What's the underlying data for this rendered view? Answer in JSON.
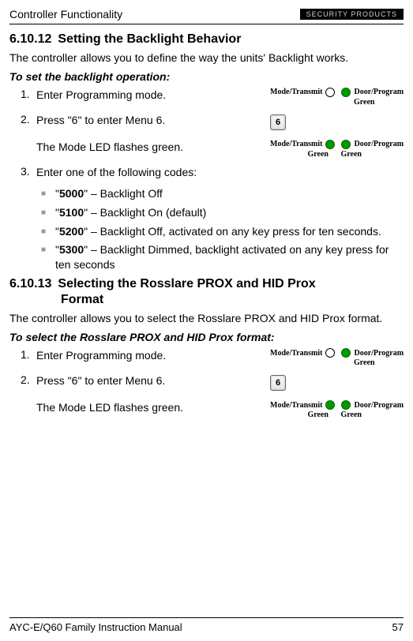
{
  "header": {
    "title": "Controller Functionality",
    "brand": "SECURITY PRODUCTS"
  },
  "s1": {
    "num": "6.10.12",
    "title": "Setting the Backlight Behavior",
    "intro": "The controller allows you to define the way the units' Backlight works.",
    "procTitle": "To set the backlight operation:",
    "step1": {
      "num": "1.",
      "text": "Enter Programming mode."
    },
    "step2": {
      "num": "2.",
      "textPre": " Press \"",
      "bold": "6",
      "textPost": "\" to enter Menu 6."
    },
    "step2b": "The Mode LED flashes green.",
    "step3": {
      "num": "3.",
      "text": "Enter one of the following codes:"
    },
    "bullets": [
      {
        "code": "5000",
        "desc": "\" – Backlight Off"
      },
      {
        "code": "5100",
        "desc": "\" – Backlight On (default)"
      },
      {
        "code": "5200",
        "desc": "\" – Backlight Off, activated on any key press for ten seconds."
      },
      {
        "code": "5300",
        "desc": "\" – Backlight Dimmed, backlight activated on any key press for ten seconds"
      }
    ]
  },
  "s2": {
    "num": "6.10.13",
    "title": "Selecting the Rosslare PROX and HID Prox",
    "title2": "Format",
    "intro": "The controller allows you to select the Rosslare PROX and HID Prox format.",
    "procTitle": "To select the Rosslare PROX and HID Prox format:",
    "step1": {
      "num": "1.",
      "text": "Enter Programming mode."
    },
    "step2": {
      "num": "2.",
      "textPre": " Press \"",
      "bold": "6",
      "textPost": "\" to enter Menu 6."
    },
    "step2b": "The Mode LED flashes green."
  },
  "led": {
    "mode": "Mode/Transmit",
    "door": "Door/Program",
    "green": "Green",
    "key6": "6"
  },
  "footer": {
    "manual": "AYC-E/Q60 Family Instruction Manual",
    "page": "57"
  }
}
